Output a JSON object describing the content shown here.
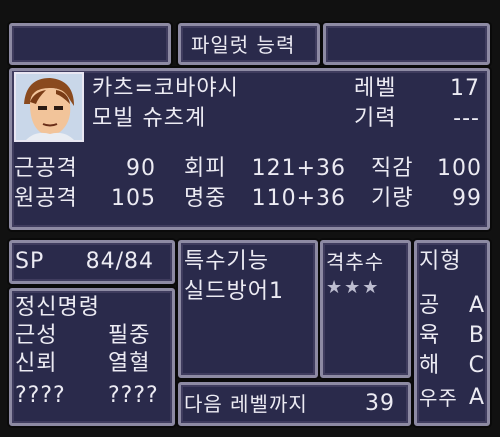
{
  "header": {
    "title": "파일럿 능력"
  },
  "pilot": {
    "name": "카츠=코바야시",
    "unit": "모빌 슈츠계",
    "level_label": "레벨",
    "level_value": "17",
    "morale_label": "기력",
    "morale_value": "---"
  },
  "stats": [
    {
      "label": "근공격",
      "value": "90"
    },
    {
      "label": "회피",
      "value": "121+36"
    },
    {
      "label": "직감",
      "value": "100"
    },
    {
      "label": "원공격",
      "value": "105"
    },
    {
      "label": "명중",
      "value": "110+36"
    },
    {
      "label": "기량",
      "value": "99"
    }
  ],
  "sp": {
    "label": "SP",
    "value": "84/84"
  },
  "skills": {
    "title": "특수기능",
    "items": [
      "실드방어1"
    ]
  },
  "shootdown": {
    "title": "격추수",
    "stars": "★★★"
  },
  "spirit": {
    "title": "정신명령",
    "commands": [
      "근성",
      "필중",
      "신뢰",
      "열혈",
      "????",
      "????"
    ]
  },
  "next_level": {
    "label": "다음 레벨까지",
    "value": "39"
  },
  "terrain": {
    "title": "지형",
    "rows": [
      {
        "label": "공",
        "rank": "A"
      },
      {
        "label": "육",
        "rank": "B"
      },
      {
        "label": "해",
        "rank": "C"
      },
      {
        "label": "우주",
        "rank": "A"
      }
    ]
  },
  "colors": {
    "panel": "#2a2a4b",
    "border": "#8d8aa3",
    "text": "#ecebf3"
  }
}
